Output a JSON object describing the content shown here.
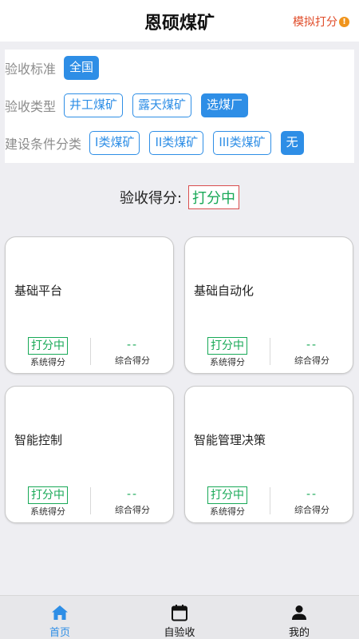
{
  "header": {
    "title": "恩硕煤矿",
    "simulate_label": "模拟打分",
    "simulate_icon": "warning-icon"
  },
  "filters": {
    "standard": {
      "label": "验收标准",
      "options": [
        "全国"
      ],
      "selected": "全国"
    },
    "type": {
      "label": "验收类型",
      "options": [
        "井工煤矿",
        "露天煤矿",
        "选煤厂"
      ],
      "selected": "选煤厂"
    },
    "condition": {
      "label": "建设条件分类",
      "options": [
        "I类煤矿",
        "II类煤矿",
        "III类煤矿",
        "无"
      ],
      "selected": "无"
    }
  },
  "score": {
    "label": "验收得分:",
    "value": "打分中"
  },
  "cards": [
    {
      "name": "基础平台",
      "system_score": "打分中",
      "system_label": "系统得分",
      "total_score": "--",
      "total_label": "综合得分"
    },
    {
      "name": "基础自动化",
      "system_score": "打分中",
      "system_label": "系统得分",
      "total_score": "--",
      "total_label": "综合得分"
    },
    {
      "name": "智能控制",
      "system_score": "打分中",
      "system_label": "系统得分",
      "total_score": "--",
      "total_label": "综合得分"
    },
    {
      "name": "智能管理决策",
      "system_score": "打分中",
      "system_label": "系统得分",
      "total_score": "--",
      "total_label": "综合得分"
    }
  ],
  "tabbar": {
    "items": [
      {
        "label": "首页",
        "icon": "home-icon",
        "active": true
      },
      {
        "label": "自验收",
        "icon": "calendar-icon",
        "active": false
      },
      {
        "label": "我的",
        "icon": "user-icon",
        "active": false
      }
    ]
  },
  "colors": {
    "accent": "#2e8ee6",
    "score_green": "#18a957",
    "alert_red": "#e04b28",
    "score_border": "#d94d4d"
  }
}
